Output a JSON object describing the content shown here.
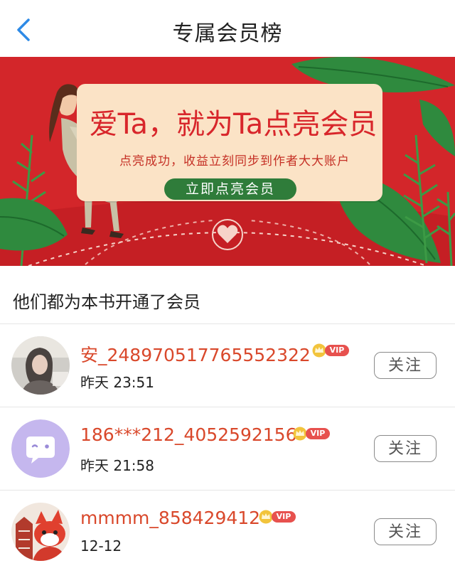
{
  "nav": {
    "title": "专属会员榜",
    "back_icon": "chevron-left-icon"
  },
  "banner": {
    "headline": "爱Ta，就为Ta点亮会员",
    "subtitle": "点亮成功，收益立刻同步到作者大大账户",
    "cta_label": "立即点亮会员",
    "colors": {
      "background": "#d3262a",
      "card": "#fbe3c6",
      "cta": "#2f7c3a",
      "leaf": "#2f8a3e"
    }
  },
  "section": {
    "title": "他们都为本书开通了会员"
  },
  "members": [
    {
      "name": "安_248970517765552322",
      "time": "昨天 23:51",
      "vip_label": "VIP",
      "follow_label": "关注",
      "avatar": "photo-avatar"
    },
    {
      "name": "186***212_4052592156",
      "time": "昨天 21:58",
      "vip_label": "VIP",
      "follow_label": "关注",
      "avatar": "default-avatar"
    },
    {
      "name": "mmmm_858429412",
      "time": "12-12",
      "vip_label": "VIP",
      "follow_label": "关注",
      "avatar": "cartoon-fox-avatar"
    }
  ],
  "colors": {
    "name": "#d9482b",
    "vip": "#e7514e",
    "crown": "#f2c43c",
    "accent_blue": "#2e8ae6"
  }
}
